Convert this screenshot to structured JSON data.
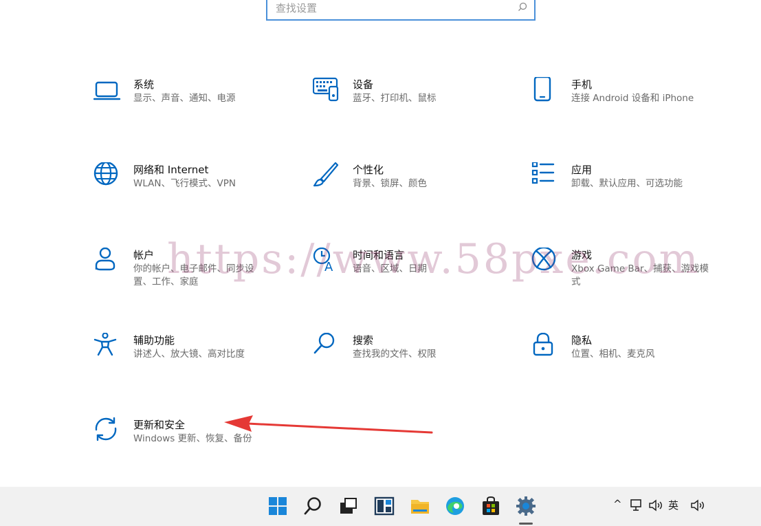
{
  "search": {
    "placeholder": "查找设置"
  },
  "tiles": [
    {
      "title": "系统",
      "desc": "显示、声音、通知、电源",
      "icon": "laptop-icon"
    },
    {
      "title": "设备",
      "desc": "蓝牙、打印机、鼠标",
      "icon": "keyboard-icon"
    },
    {
      "title": "手机",
      "desc": "连接 Android 设备和 iPhone",
      "icon": "phone-icon"
    },
    {
      "title": "网络和 Internet",
      "desc": "WLAN、飞行模式、VPN",
      "icon": "globe-icon"
    },
    {
      "title": "个性化",
      "desc": "背景、锁屏、颜色",
      "icon": "brush-icon"
    },
    {
      "title": "应用",
      "desc": "卸载、默认应用、可选功能",
      "icon": "apps-list-icon"
    },
    {
      "title": "帐户",
      "desc": "你的帐户、电子邮件、同步设置、工作、家庭",
      "icon": "person-icon"
    },
    {
      "title": "时间和语言",
      "desc": "语音、区域、日期",
      "icon": "clock-language-icon"
    },
    {
      "title": "游戏",
      "desc": "Xbox Game Bar、捕获、游戏模式",
      "icon": "xbox-icon"
    },
    {
      "title": "辅助功能",
      "desc": "讲述人、放大镜、高对比度",
      "icon": "accessibility-icon"
    },
    {
      "title": "搜索",
      "desc": "查找我的文件、权限",
      "icon": "search-icon"
    },
    {
      "title": "隐私",
      "desc": "位置、相机、麦克风",
      "icon": "lock-icon"
    },
    {
      "title": "更新和安全",
      "desc": "Windows 更新、恢复、备份",
      "icon": "sync-icon"
    }
  ],
  "watermark": "https://www.58pxe.com",
  "taskbar": {
    "items": [
      "windows-start-icon",
      "search-icon",
      "task-view-icon",
      "widgets-icon",
      "file-explorer-icon",
      "edge-icon",
      "store-icon",
      "settings-gear-icon"
    ],
    "tray": {
      "chevron": "^",
      "ime": "英"
    }
  },
  "colors": {
    "accent": "#0067c0",
    "arrow": "#e53935",
    "taskbar": "#f1f1f1"
  }
}
